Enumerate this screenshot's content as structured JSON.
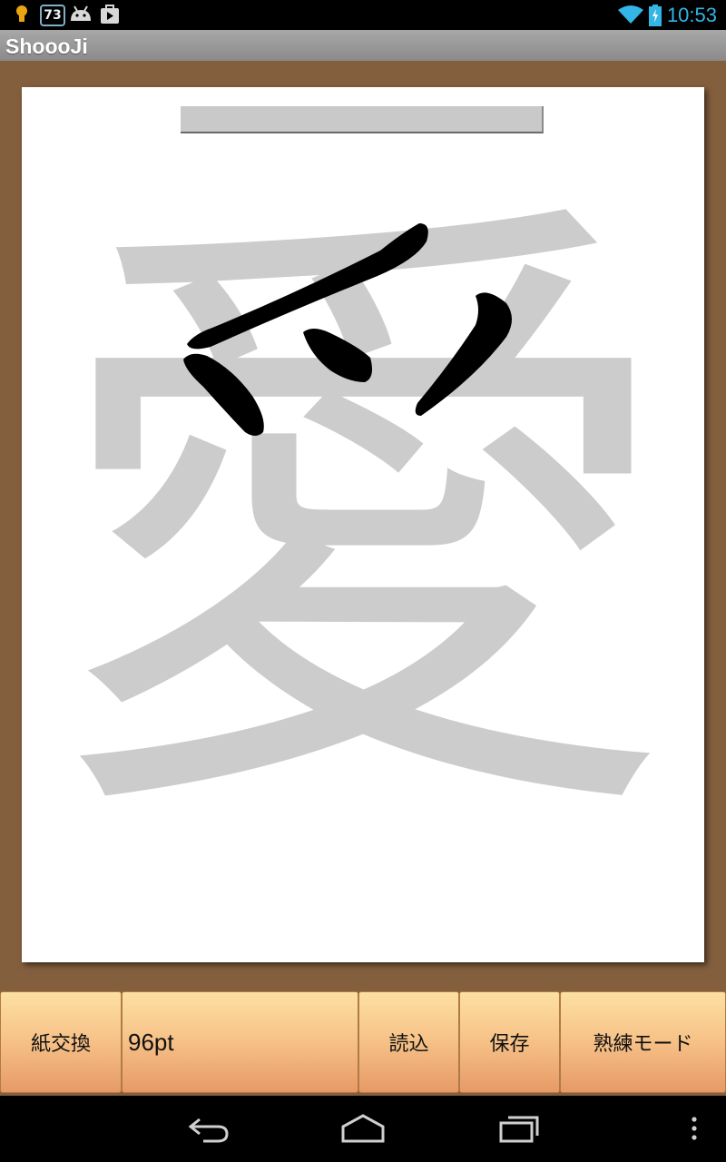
{
  "status_bar": {
    "notification_badge": "73",
    "time": "10:53",
    "icons": [
      "lightbulb-icon",
      "android-icon",
      "play-store-icon",
      "wifi-icon",
      "battery-icon"
    ]
  },
  "app": {
    "title": "ShoooJi"
  },
  "canvas": {
    "guide_character": "愛",
    "guide_color": "#cccccc",
    "ink_color": "#000000"
  },
  "toolbar": {
    "paper_label": "紙交換",
    "brush_size": "96pt",
    "load_label": "読込",
    "save_label": "保存",
    "mode_label": "熟練モード"
  },
  "colors": {
    "board": "#845f3e",
    "button_top": "#fde0a2",
    "button_bottom": "#e79a66",
    "clock": "#33b5e5"
  },
  "nav_bar": {
    "buttons": [
      "back-icon",
      "home-icon",
      "recents-icon",
      "overflow-menu-icon"
    ]
  }
}
